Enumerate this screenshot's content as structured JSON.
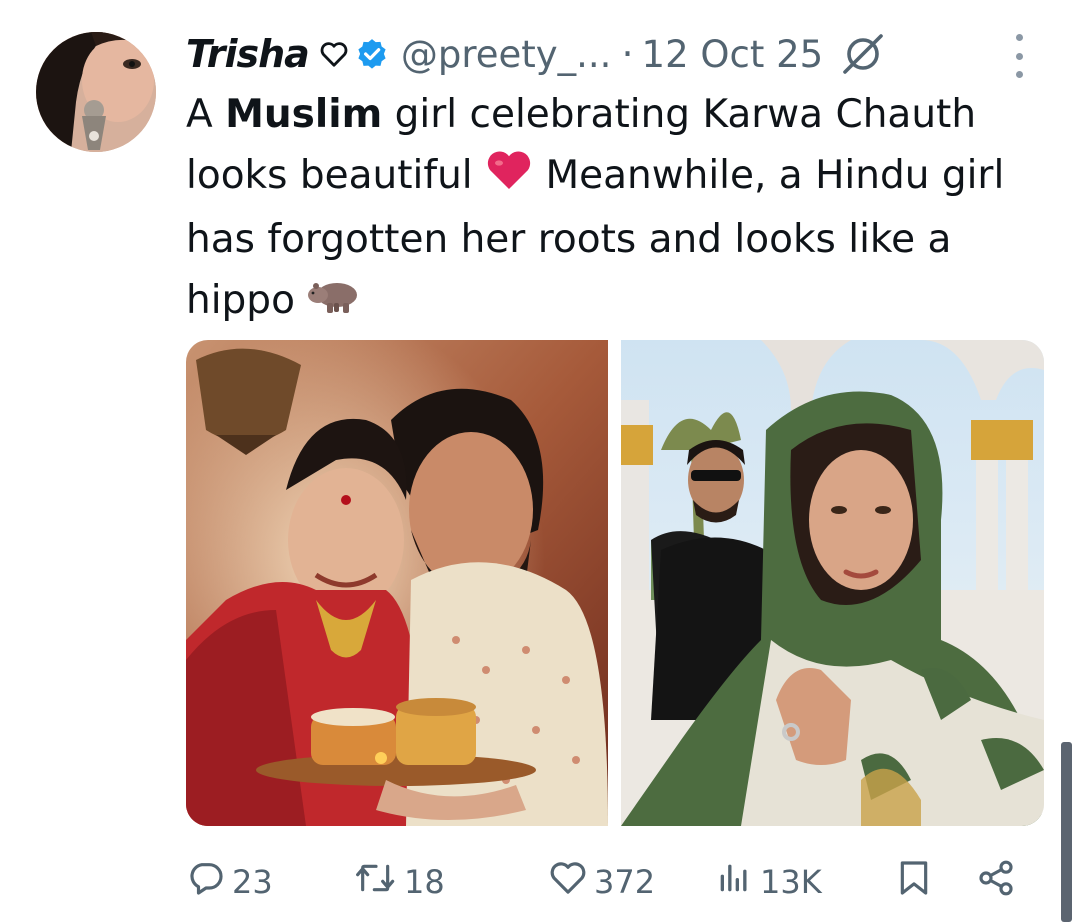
{
  "author": {
    "name": "Trisha",
    "handle": "@preety_...",
    "separator": "·",
    "date": "12 Oct 25",
    "verified": true
  },
  "tweet": {
    "text_before_bold": "A ",
    "bold_word": "Muslim",
    "text_line1_rest": " girl celebrating Karwa Chauth",
    "text_line2a": "looks beautiful ",
    "heart_emoji": "red-heart-emoji",
    "text_line2b": " Meanwhile, a Hindu girl",
    "text_line3": "has forgotten her roots and looks like a",
    "text_line4": "hippo ",
    "hippo_emoji": "hippopotamus-emoji"
  },
  "media": [
    {
      "name": "couple-karwa-chauth-photo"
    },
    {
      "name": "woman-mosque-selfie-photo"
    }
  ],
  "actions": {
    "replies": "23",
    "reposts": "18",
    "likes": "372",
    "views": "13K"
  },
  "colors": {
    "text": "#0f1419",
    "secondary": "#536471",
    "verified_blue": "#1d9bf0",
    "heart_red": "#e0245e"
  },
  "icons": [
    "heart-outline-icon",
    "verified-badge-icon",
    "grok-icon",
    "more-icon",
    "reply-icon",
    "repost-icon",
    "like-icon",
    "views-icon",
    "bookmark-icon",
    "share-icon"
  ]
}
